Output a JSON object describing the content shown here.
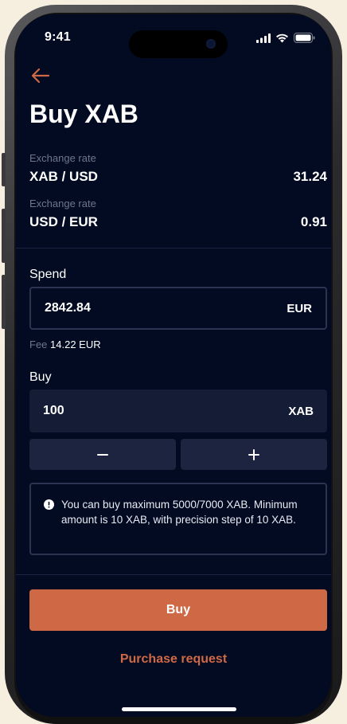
{
  "status_bar": {
    "time": "9:41",
    "icons": [
      "signal-icon",
      "wifi-icon",
      "battery-icon"
    ]
  },
  "header": {
    "back_icon": "arrow-left-icon",
    "title": "Buy XAB"
  },
  "exchange_rates": [
    {
      "label": "Exchange rate",
      "pair": "XAB / USD",
      "value": "31.24"
    },
    {
      "label": "Exchange rate",
      "pair": "USD / EUR",
      "value": "0.91"
    }
  ],
  "spend": {
    "label": "Spend",
    "value": "2842.84",
    "unit": "EUR"
  },
  "fee": {
    "label": "Fee",
    "value": "14.22 EUR"
  },
  "buy": {
    "label": "Buy",
    "value": "100",
    "unit": "XAB",
    "decrement_icon": "minus-icon",
    "increment_icon": "plus-icon"
  },
  "info": {
    "icon": "info-icon",
    "text": "You can buy maximum 5000/7000 XAB. Minimum amount is 10 XAB, with precision step of 10 XAB."
  },
  "actions": {
    "buy_label": "Buy",
    "request_label": "Purchase request"
  },
  "colors": {
    "background": "#030b22",
    "accent": "#cf6845",
    "field": "#151c35",
    "muted_text": "#6d7691"
  }
}
